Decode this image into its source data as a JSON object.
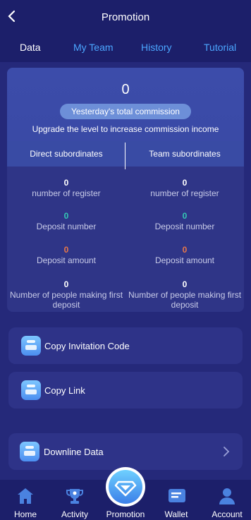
{
  "header": {
    "title": "Promotion",
    "back_icon": "chevron-left-icon"
  },
  "tabs": [
    {
      "label": "Data",
      "active": true
    },
    {
      "label": "My Team",
      "active": false
    },
    {
      "label": "History",
      "active": false
    },
    {
      "label": "Tutorial",
      "active": false
    }
  ],
  "summary": {
    "total_value": "0",
    "commission_label": "Yesterday's total commission",
    "upgrade_text": "Upgrade the level to increase commission income"
  },
  "subordinates": {
    "direct": {
      "title": "Direct subordinates",
      "register_value": "0",
      "register_label": "number of register",
      "deposit_number_value": "0",
      "deposit_number_label": "Deposit number",
      "deposit_amount_value": "0",
      "deposit_amount_label": "Deposit amount",
      "first_deposit_value": "0",
      "first_deposit_label": "Number of people making first deposit"
    },
    "team": {
      "title": "Team subordinates",
      "register_value": "0",
      "register_label": "number of register",
      "deposit_number_value": "0",
      "deposit_number_label": "Deposit number",
      "deposit_amount_value": "0",
      "deposit_amount_label": "Deposit amount",
      "first_deposit_value": "0",
      "first_deposit_label": "Number of people making first deposit"
    }
  },
  "actions": {
    "copy_code": "Copy Invitation Code",
    "copy_link": "Copy Link",
    "downline": "Downline Data"
  },
  "nav": [
    {
      "label": "Home",
      "icon": "home-icon"
    },
    {
      "label": "Activity",
      "icon": "trophy-icon"
    },
    {
      "label": "Promotion",
      "icon": "diamond-icon"
    },
    {
      "label": "Wallet",
      "icon": "wallet-icon"
    },
    {
      "label": "Account",
      "icon": "person-icon"
    }
  ],
  "colors": {
    "background": "#25297a",
    "accent_blue": "#4ba6ff",
    "teal": "#34c8b4",
    "orange": "#e8784a"
  }
}
